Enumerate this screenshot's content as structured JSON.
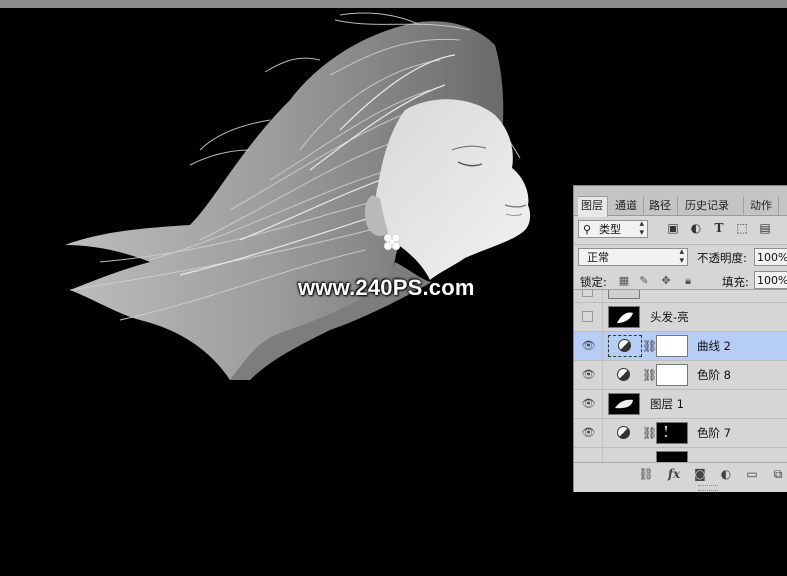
{
  "watermark": "www.240PS.com",
  "panel": {
    "tabs": [
      {
        "label": "图层",
        "active": true
      },
      {
        "label": "通道",
        "active": false
      },
      {
        "label": "路径",
        "active": false
      },
      {
        "label": "历史记录",
        "active": false
      },
      {
        "label": "动作",
        "active": false
      }
    ],
    "filter": {
      "value": "类型",
      "search_icon": "search-icon"
    },
    "filter_icons": [
      "image-filter-icon",
      "adjustment-filter-icon",
      "text-filter-icon",
      "shape-filter-icon",
      "smart-object-filter-icon"
    ],
    "blend_mode": "正常",
    "opacity_label": "不透明度:",
    "opacity_value": "100%",
    "lock_label": "锁定:",
    "fill_label": "填充:",
    "fill_value": "100%",
    "layers": [
      {
        "name": "",
        "visible": false,
        "partial": true
      },
      {
        "name": "头发-亮",
        "visible": false,
        "selected": false
      },
      {
        "name": "曲线 2",
        "visible": true,
        "selected": true,
        "adjustment": true
      },
      {
        "name": "色阶 8",
        "visible": true,
        "selected": false,
        "adjustment": true
      },
      {
        "name": "图层 1",
        "visible": true,
        "selected": false
      },
      {
        "name": "色阶 7",
        "visible": true,
        "selected": false,
        "adjustment": true
      }
    ],
    "bottom_icons": [
      "link-layers-icon",
      "fx-icon",
      "add-mask-icon",
      "new-adjustment-icon",
      "new-group-icon",
      "new-layer-icon"
    ],
    "fx_label": "fx"
  },
  "colors": {
    "selection": "#b6cdf6",
    "panel_bg": "#d6d6d6",
    "canvas_bg": "#000000"
  }
}
